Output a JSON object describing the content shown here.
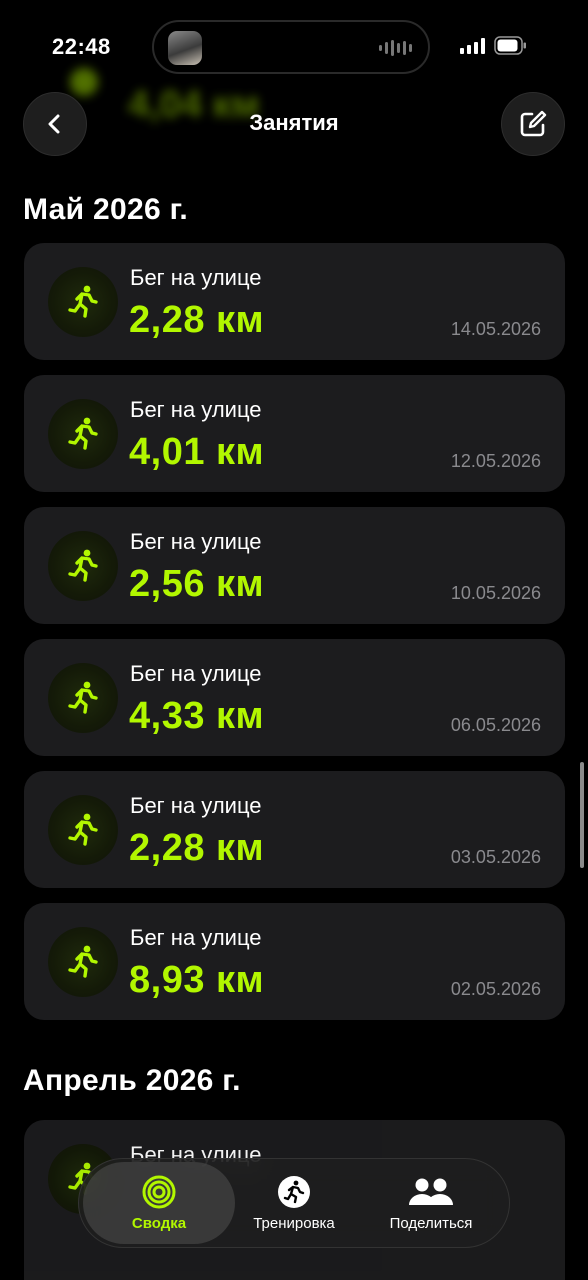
{
  "status_bar": {
    "time": "22:48"
  },
  "header": {
    "title": "Занятия"
  },
  "sections": [
    {
      "title": "Май 2026 г.",
      "items": [
        {
          "type": "Бег на улице",
          "distance": "2,28 км",
          "date": "14.05.2026"
        },
        {
          "type": "Бег на улице",
          "distance": "4,01 км",
          "date": "12.05.2026"
        },
        {
          "type": "Бег на улице",
          "distance": "2,56 км",
          "date": "10.05.2026"
        },
        {
          "type": "Бег на улице",
          "distance": "4,33 км",
          "date": "06.05.2026"
        },
        {
          "type": "Бег на улице",
          "distance": "2,28 км",
          "date": "03.05.2026"
        },
        {
          "type": "Бег на улице",
          "distance": "8,93 км",
          "date": "02.05.2026"
        }
      ]
    },
    {
      "title": "Апрель 2026 г.",
      "items": [
        {
          "type": "Бег на улице"
        }
      ]
    }
  ],
  "ghost_above": {
    "distance": "4,04 км"
  },
  "tabbar": {
    "tabs": [
      {
        "label": "Сводка",
        "icon": "activity-rings-icon",
        "selected": true
      },
      {
        "label": "Тренировка",
        "icon": "running-figure-icon"
      },
      {
        "label": "Поделиться",
        "icon": "people-icon"
      }
    ]
  },
  "colors": {
    "accent": "#b2f700",
    "card": "#1c1c1e",
    "secondary_text": "#8a8a8e"
  }
}
